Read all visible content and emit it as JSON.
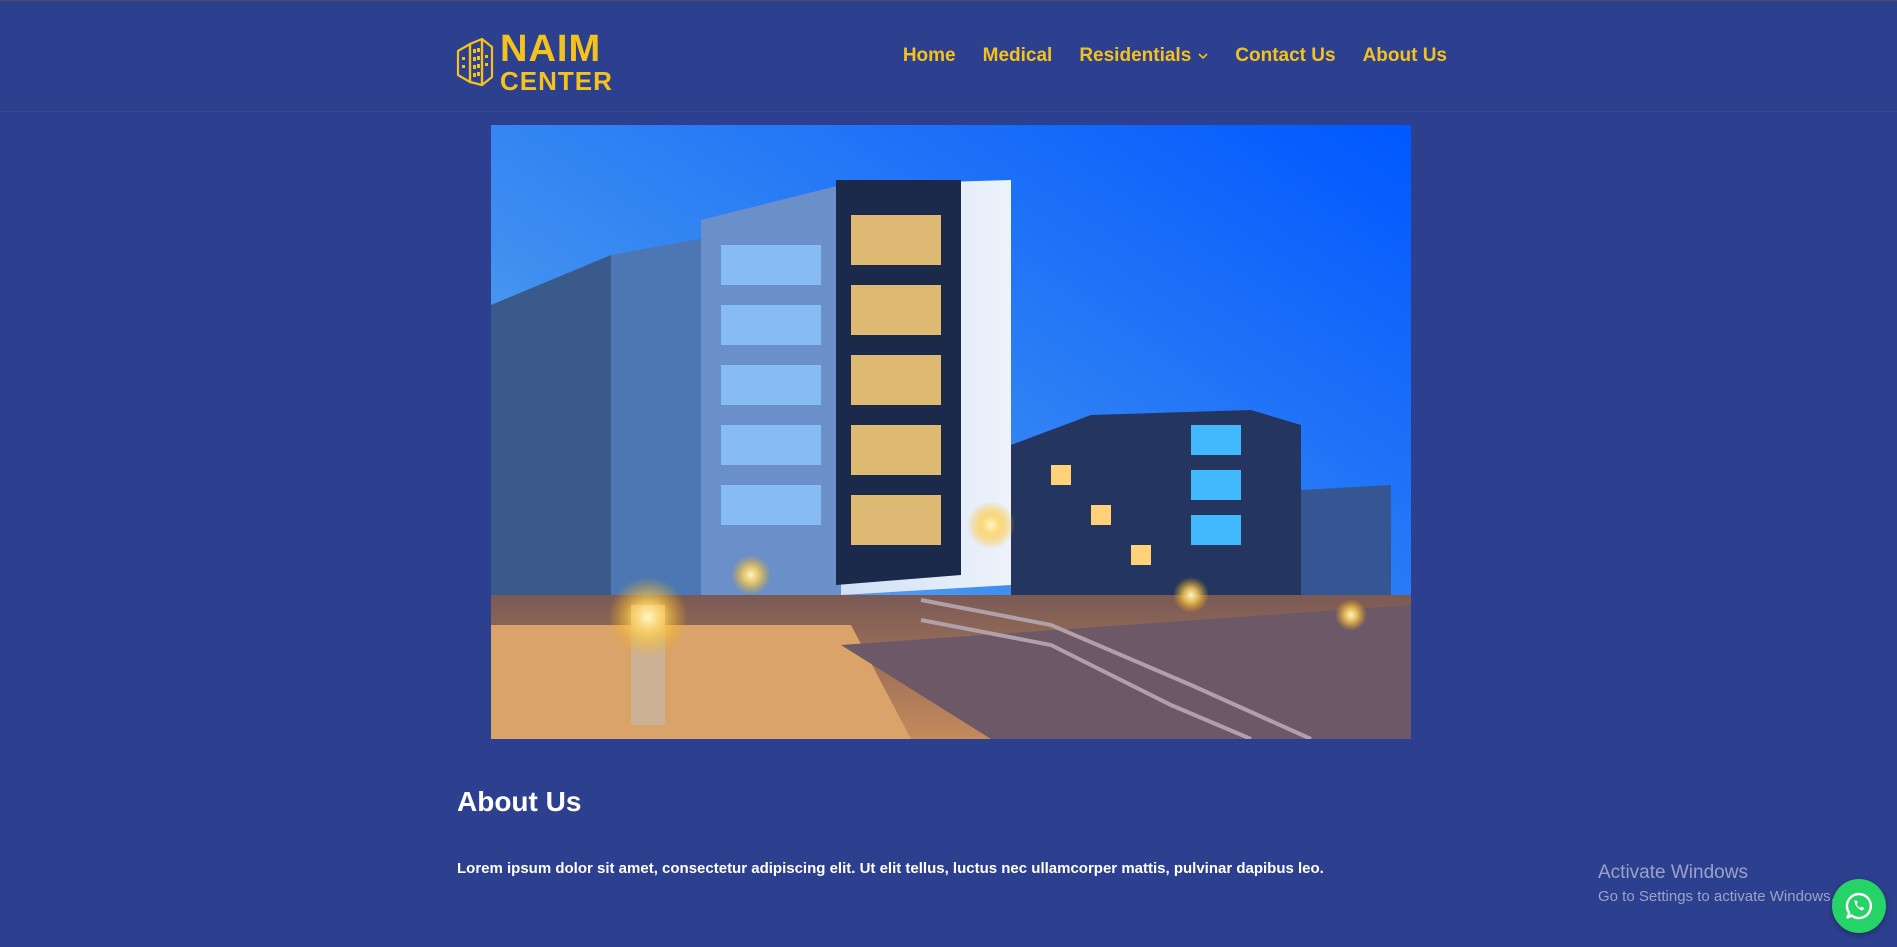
{
  "brand": {
    "line1": "NAIM",
    "line2": "CENTER",
    "color": "#f4c21c"
  },
  "nav": {
    "items": [
      {
        "label": "Home"
      },
      {
        "label": "Medical"
      },
      {
        "label": "Residentials",
        "has_dropdown": true
      },
      {
        "label": "Contact Us"
      },
      {
        "label": "About Us"
      }
    ]
  },
  "hero": {
    "subject": "modern apartment buildings at dusk"
  },
  "about": {
    "title": "About Us",
    "body": "Lorem ipsum dolor sit amet, consectetur adipiscing elit. Ut elit tellus, luctus nec ullamcorper mattis, pulvinar dapibus leo."
  },
  "watermark": {
    "line1": "Activate Windows",
    "line2": "Go to Settings to activate Windows."
  },
  "floating": {
    "icon": "whatsapp-icon",
    "color": "#25d366"
  },
  "colors": {
    "background": "#2d3f8f",
    "accent": "#f4c21c"
  }
}
